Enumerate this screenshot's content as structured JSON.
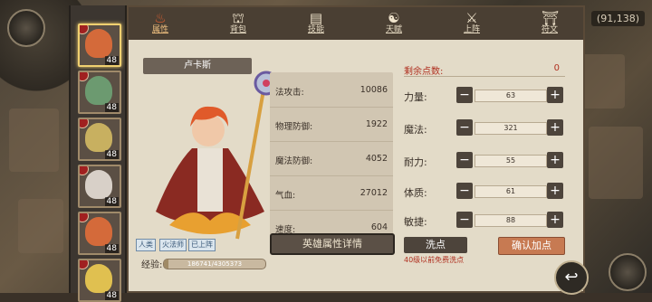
{
  "map": {
    "coordinates": "(91,138)"
  },
  "roster": [
    {
      "level": "48",
      "color": "#d46a3a"
    },
    {
      "level": "48",
      "color": "#6c9a70"
    },
    {
      "level": "48",
      "color": "#c8b060"
    },
    {
      "level": "48",
      "color": "#d8d0c8"
    },
    {
      "level": "48",
      "color": "#d46a3a"
    },
    {
      "level": "48",
      "color": "#e0c050"
    }
  ],
  "tabs": [
    {
      "label": "属性",
      "icon": "flame-icon",
      "glyph": "♨"
    },
    {
      "label": "背包",
      "icon": "backpack-icon",
      "glyph": "⛫"
    },
    {
      "label": "技能",
      "icon": "skill-book-icon",
      "glyph": "▤"
    },
    {
      "label": "天赋",
      "icon": "talent-icon",
      "glyph": "☯"
    },
    {
      "label": "上阵",
      "icon": "crossed-swords-icon",
      "glyph": "⚔"
    },
    {
      "label": "符文",
      "icon": "rune-icon",
      "glyph": "⛩"
    }
  ],
  "hero": {
    "name": "卢卡斯",
    "tags": [
      "人类",
      "火法师",
      "已上阵"
    ],
    "exp_label": "经验:",
    "exp_text": "186741/4305373",
    "exp_progress": 0.043
  },
  "stats": [
    {
      "label": "法攻击:",
      "value": "10086"
    },
    {
      "label": "物理防御:",
      "value": "1922"
    },
    {
      "label": "魔法防御:",
      "value": "4052"
    },
    {
      "label": "气血:",
      "value": "27012"
    },
    {
      "label": "速度:",
      "value": "604"
    }
  ],
  "detail_button": "英雄属性详情",
  "points": {
    "remain_label": "剩余点数:",
    "remain_value": "0",
    "rows": [
      {
        "label": "力量:",
        "value": "63"
      },
      {
        "label": "魔法:",
        "value": "321"
      },
      {
        "label": "耐力:",
        "value": "55"
      },
      {
        "label": "体质:",
        "value": "61"
      },
      {
        "label": "敏捷:",
        "value": "88"
      }
    ],
    "minus": "−",
    "plus": "+"
  },
  "buttons": {
    "reset": "洗点",
    "confirm": "确认加点"
  },
  "free_note": "40级以前免费洗点",
  "colors": {
    "accent_red": "#b03020",
    "confirm": "#c77a52",
    "panel": "#e3dbc8"
  }
}
